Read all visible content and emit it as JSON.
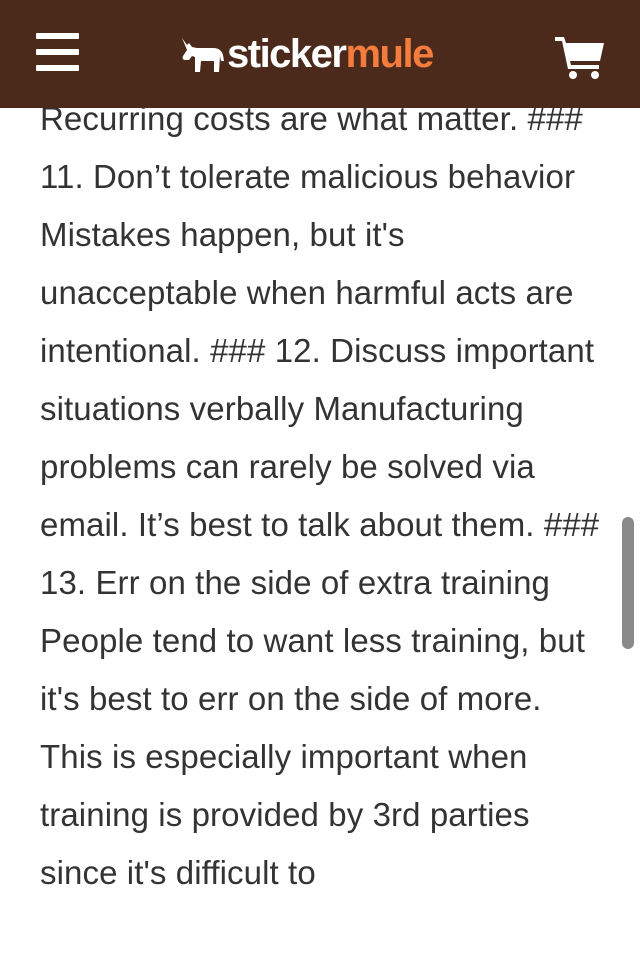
{
  "header": {
    "brand_part1": "sticker",
    "brand_part2": "mule",
    "colors": {
      "background": "#4b2a1c",
      "brand_accent": "#f47c3c",
      "text": "#ffffff"
    },
    "icons": {
      "menu": "hamburger-menu-icon",
      "logo": "mule-logo-icon",
      "cart": "shopping-cart-icon"
    }
  },
  "article": {
    "text": "Recurring costs are what matter. ### 11. Don’t tolerate malicious behavior Mistakes happen, but it's unacceptable when harmful acts are intentional. ### 12. Discuss important situations verbally Manufacturing problems can rarely be solved via email. It’s best to talk about them. ### 13. Err on the side of extra training People tend to want less training, but it's best to err on the side of more. This is especially important when training is provided by 3rd parties since it's difficult to"
  }
}
